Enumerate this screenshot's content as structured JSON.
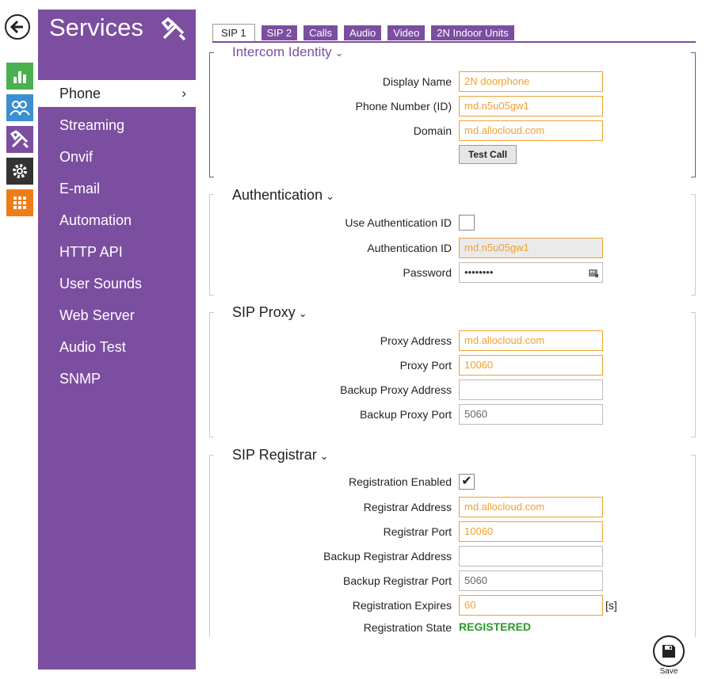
{
  "sidebar": {
    "title": "Services",
    "items": [
      {
        "label": "Phone",
        "chevron": "›"
      },
      {
        "label": "Streaming"
      },
      {
        "label": "Onvif"
      },
      {
        "label": "E-mail"
      },
      {
        "label": "Automation"
      },
      {
        "label": "HTTP API"
      },
      {
        "label": "User Sounds"
      },
      {
        "label": "Web Server"
      },
      {
        "label": "Audio Test"
      },
      {
        "label": "SNMP"
      }
    ]
  },
  "tabs": [
    "SIP 1",
    "SIP 2",
    "Calls",
    "Audio",
    "Video",
    "2N Indoor Units"
  ],
  "caret": "⌄",
  "identity": {
    "title": "Intercom Identity",
    "display_name_label": "Display Name",
    "display_name_value": "2N doorphone",
    "phone_number_label": "Phone Number (ID)",
    "phone_number_value": "md.n5u05gw1",
    "domain_label": "Domain",
    "domain_value": "md.allocloud.com",
    "test_call_label": "Test Call"
  },
  "auth": {
    "title": "Authentication",
    "use_auth_id_label": "Use Authentication ID",
    "auth_id_label": "Authentication ID",
    "auth_id_value": "md.n5u05gw1",
    "password_label": "Password",
    "password_value": "••••••••"
  },
  "proxy": {
    "title": "SIP Proxy",
    "address_label": "Proxy Address",
    "address_value": "md.allocloud.com",
    "port_label": "Proxy Port",
    "port_value": "10060",
    "backup_address_label": "Backup Proxy Address",
    "backup_address_value": "",
    "backup_port_label": "Backup Proxy Port",
    "backup_port_value": "5060"
  },
  "registrar": {
    "title": "SIP Registrar",
    "enabled_label": "Registration Enabled",
    "enabled_check": "✔",
    "address_label": "Registrar Address",
    "address_value": "md.allocloud.com",
    "port_label": "Registrar Port",
    "port_value": "10060",
    "backup_address_label": "Backup Registrar Address",
    "backup_address_value": "",
    "backup_port_label": "Backup Registrar Port",
    "backup_port_value": "5060",
    "expires_label": "Registration Expires",
    "expires_value": "60",
    "expires_unit": "[s]",
    "state_label": "Registration State",
    "state_value": "REGISTERED"
  },
  "save_label": "Save",
  "colors": {
    "accent": "#7b4ea0",
    "field_highlight": "#f0a030",
    "ok": "#2a9a2a"
  }
}
